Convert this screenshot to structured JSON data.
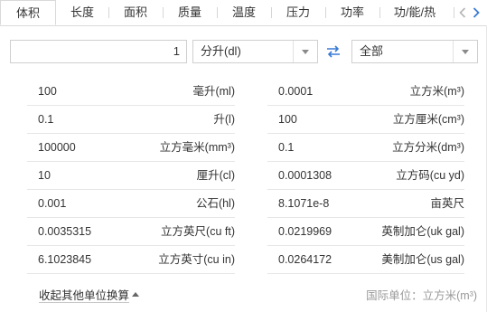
{
  "tabs": [
    {
      "label": "体积",
      "active": true
    },
    {
      "label": "长度"
    },
    {
      "label": "面积"
    },
    {
      "label": "质量"
    },
    {
      "label": "温度"
    },
    {
      "label": "压力"
    },
    {
      "label": "功率"
    },
    {
      "label": "功/能/热"
    }
  ],
  "converter": {
    "input_value": "1",
    "from_unit": "分升(dl)",
    "to_unit": "全部"
  },
  "results_left": [
    {
      "value": "100",
      "unit": "毫升(ml)"
    },
    {
      "value": "0.1",
      "unit": "升(l)"
    },
    {
      "value": "100000",
      "unit": "立方毫米(mm³)"
    },
    {
      "value": "10",
      "unit": "厘升(cl)"
    },
    {
      "value": "0.001",
      "unit": "公石(hl)"
    },
    {
      "value": "0.0035315",
      "unit": "立方英尺(cu ft)"
    },
    {
      "value": "6.1023845",
      "unit": "立方英寸(cu in)"
    }
  ],
  "results_right": [
    {
      "value": "0.0001",
      "unit": "立方米(m³)"
    },
    {
      "value": "100",
      "unit": "立方厘米(cm³)"
    },
    {
      "value": "0.1",
      "unit": "立方分米(dm³)"
    },
    {
      "value": "0.0001308",
      "unit": "立方码(cu yd)"
    },
    {
      "value": "8.1071e-8",
      "unit": "亩英尺"
    },
    {
      "value": "0.0219969",
      "unit": "英制加仑(uk gal)"
    },
    {
      "value": "0.0264172",
      "unit": "美制加仑(us gal)"
    }
  ],
  "footer": {
    "collapse_label": "收起其他单位换算",
    "si_unit_label": "国际单位：立方米(m³)"
  },
  "colors": {
    "border": "#cfcfcf",
    "divider": "#e6e6e6",
    "swap_icon": "#3a7bd5",
    "muted_text": "#999999"
  }
}
